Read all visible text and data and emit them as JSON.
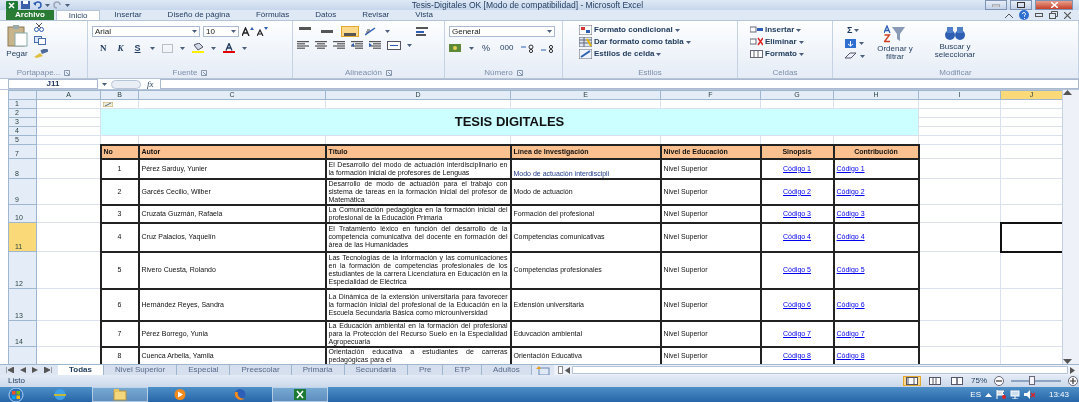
{
  "window": {
    "title": "Tesis-Digitales OK  [Modo de compatibilidad]  -  Microsoft Excel"
  },
  "ribbon_tabs": [
    {
      "label": "Archivo",
      "kind": "file",
      "selected": false
    },
    {
      "label": "Inicio",
      "kind": "tab",
      "selected": true
    },
    {
      "label": "Insertar",
      "kind": "tab",
      "selected": false
    },
    {
      "label": "Diseño de página",
      "kind": "tab",
      "selected": false
    },
    {
      "label": "Fórmulas",
      "kind": "tab",
      "selected": false
    },
    {
      "label": "Datos",
      "kind": "tab",
      "selected": false
    },
    {
      "label": "Revisar",
      "kind": "tab",
      "selected": false
    },
    {
      "label": "Vista",
      "kind": "tab",
      "selected": false
    }
  ],
  "clipboard": {
    "paste": "Pegar",
    "label": "Portapape..."
  },
  "font_group": {
    "font_name": "Arial",
    "font_size": "10",
    "bold": "N",
    "italic": "K",
    "underline": "S",
    "label": "Fuente"
  },
  "alignment_group": {
    "vertical": [
      {
        "selected": false
      },
      {
        "selected": false
      },
      {
        "selected": true
      }
    ],
    "label": "Alineación"
  },
  "number_group": {
    "format": "General",
    "percent": "%",
    "thousands": "000",
    "label": "Número"
  },
  "styles_group": {
    "items": [
      "Formato condicional",
      "Dar formato como tabla",
      "Estilos de celda"
    ],
    "label": "Estilos"
  },
  "cells_group": {
    "items": [
      "Insertar",
      "Eliminar",
      "Formato"
    ],
    "label": "Celdas"
  },
  "editing_group": {
    "sum": "Σ",
    "sort": "Ordenar y filtrar",
    "find": "Buscar y seleccionar",
    "label": "Modificar"
  },
  "formula_bar": {
    "name_box": "J11",
    "fx": "fx"
  },
  "columns": [
    {
      "label": "A",
      "selected": false
    },
    {
      "label": "B",
      "selected": false
    },
    {
      "label": "C",
      "selected": false
    },
    {
      "label": "D",
      "selected": false
    },
    {
      "label": "E",
      "selected": false
    },
    {
      "label": "F",
      "selected": false
    },
    {
      "label": "G",
      "selected": false
    },
    {
      "label": "H",
      "selected": false
    },
    {
      "label": "I",
      "selected": false
    },
    {
      "label": "J",
      "selected": true
    }
  ],
  "sheet": {
    "title": "TESIS DIGITALES",
    "title_rows": [
      "1",
      "2",
      "3",
      "4",
      "5"
    ],
    "header_row": "7",
    "headers": [
      "No",
      "Autor",
      "Título",
      "Línea de Investigación",
      "Nivel de Educación",
      "Sinopsis",
      "Contribución"
    ],
    "rows": [
      {
        "label": "8",
        "selected": false,
        "no": "1",
        "author": "Pérez Sarduy, Yunier",
        "title": "El Desarrollo del modo de actuación interdisciplinario en la formación inicial de profesores de Lenguas",
        "line": "Modo de actuación interdiscipli",
        "level": "Nivel Superior",
        "synopsis": "Código 1",
        "contribution": "Código 1"
      },
      {
        "label": "9",
        "selected": false,
        "no": "2",
        "author": "Garcés Cecilio, Wilber",
        "title": "Desarrollo de modo de actuación para el trabajo con sistema de tareas en la formación inicial del profesor de Matemática",
        "line": "Modo de actuación",
        "level": "Nivel Superior",
        "synopsis": "Código 2",
        "contribution": "Código 2"
      },
      {
        "label": "10",
        "selected": false,
        "no": "3",
        "author": "Cruzata Guzmán, Rafaela",
        "title": "La Comunicación pedagógica en la formación inicial del profesional de la Educación Primaria",
        "line": "Formación del profesional",
        "level": "Nivel Superior",
        "synopsis": "Código 3",
        "contribution": "Código 3"
      },
      {
        "label": "11",
        "selected": true,
        "no": "4",
        "author": "Cruz Palacios, Yaquelín",
        "title": "El Tratamiento léxico en función del desarrollo de la competencia comunicativa del docente en formación del área de las Humanidades",
        "line": "Competencias comunicativas",
        "level": "Nivel Superior",
        "synopsis": "Código 4",
        "contribution": "Código 4"
      },
      {
        "label": "12",
        "selected": false,
        "no": "5",
        "author": "Rivero Cuesta, Rolando",
        "title": "Las Tecnologías de la información y las comunicaciones en la formación de competencias profesionales de los estudiantes de la carrera Licenciatura en Educación en la Especialidad de Eléctrica",
        "line": "Competencias profesionales",
        "level": "Nivel Superior",
        "synopsis": "Código 5",
        "contribution": "Código 5"
      },
      {
        "label": "13",
        "selected": false,
        "no": "6",
        "author": "Hernández Reyes, Sandra",
        "title": "La Dinámica de la extensión universitaria para favorecer la formación inicial del profesional de la Educación en la Escuela Secundaria Básica como microuniversidad",
        "line": "Extensión universitaria",
        "level": "Nivel Superior",
        "synopsis": "Código 6",
        "contribution": "Código 6"
      },
      {
        "label": "14",
        "selected": false,
        "no": "7",
        "author": "Pérez Borrego, Yunia",
        "title": "La Educación ambiental en la formación del profesional para la Protección del Recurso Suelo en la Especialidad Agropecuaria",
        "line": "Eduvcación ambiental",
        "level": "Nivel Superior",
        "synopsis": "Código 7",
        "contribution": "Código 7"
      },
      {
        "selected": false,
        "no": "8",
        "author": "Cuenca Arbella, Yamila",
        "title": "Orientación educativa a estudiantes de carreras pedagógicas para el",
        "line": "Orientación Educativa",
        "level": "Nivel Superior",
        "synopsis": "Código 8",
        "contribution": "Código 8"
      }
    ]
  },
  "sheet_tabs": [
    {
      "label": "Todas",
      "selected": true
    },
    {
      "label": "Nivel Superior",
      "selected": false
    },
    {
      "label": "Especial",
      "selected": false
    },
    {
      "label": "Preescolar",
      "selected": false
    },
    {
      "label": "Primaria",
      "selected": false
    },
    {
      "label": "Secundaria",
      "selected": false
    },
    {
      "label": "Pre",
      "selected": false
    },
    {
      "label": "ETP",
      "selected": false
    },
    {
      "label": "Adultos",
      "selected": false
    }
  ],
  "status_bar": {
    "text": "Listo",
    "zoom": "75%",
    "views": [
      {
        "selected": true
      },
      {
        "selected": false
      },
      {
        "selected": false
      }
    ],
    "zoom_slider": {
      "level": 0.4
    }
  },
  "taskbar": {
    "apps": [
      {
        "kind": "browser",
        "running": false
      },
      {
        "kind": "folder",
        "running": true
      },
      {
        "kind": "media",
        "running": false
      },
      {
        "kind": "firefox",
        "running": false
      },
      {
        "kind": "excel",
        "running": true
      }
    ],
    "language": "ES",
    "time": "13:43"
  }
}
